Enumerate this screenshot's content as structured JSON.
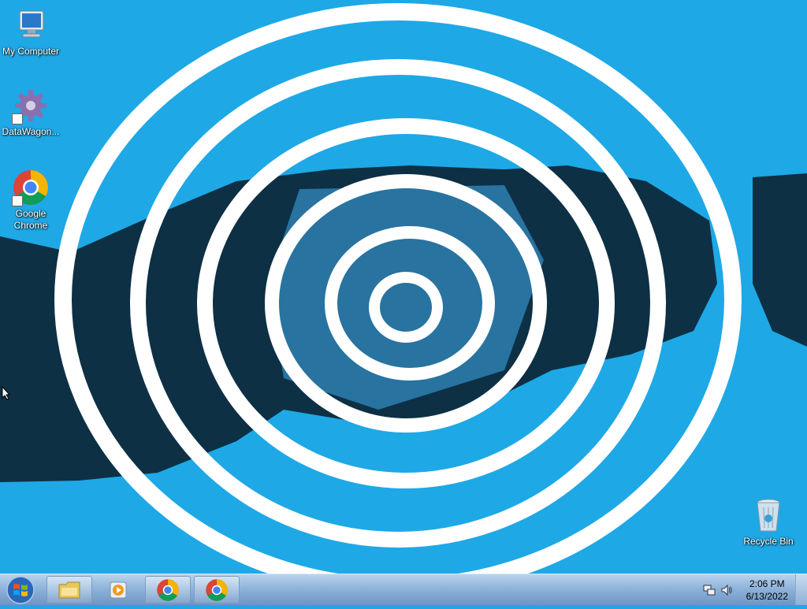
{
  "desktop": {
    "icons": [
      {
        "label": "My Computer",
        "icon": "computer-icon"
      },
      {
        "label": "DataWagon...",
        "icon": "gear-icon"
      },
      {
        "label": "Google Chrome",
        "icon": "chrome-icon"
      },
      {
        "label": "Recycle Bin",
        "icon": "recycle-bin-icon"
      }
    ]
  },
  "taskbar": {
    "start_icon": "windows-logo-icon",
    "pinned": [
      {
        "icon": "folder-icon"
      },
      {
        "icon": "media-player-icon"
      },
      {
        "icon": "chrome-icon"
      },
      {
        "icon": "chrome-icon"
      }
    ],
    "clock": {
      "time": "2:06 PM",
      "date": "6/13/2022"
    }
  },
  "colors": {
    "wallpaper": "#1ea8e6",
    "swirl": "#ffffff",
    "dark": "#0b2233"
  }
}
